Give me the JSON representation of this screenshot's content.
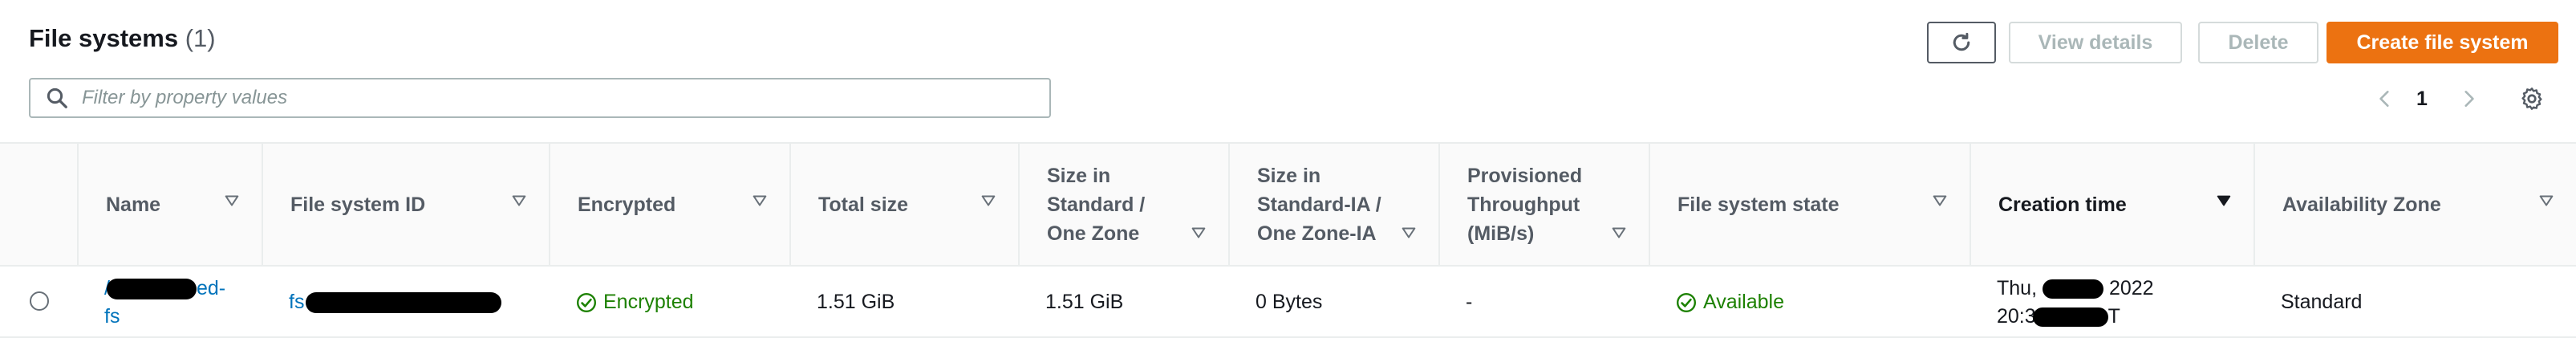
{
  "header": {
    "title": "File systems",
    "count": "(1)"
  },
  "toolbar": {
    "refresh_icon": "refresh-icon",
    "view_details_label": "View details",
    "delete_label": "Delete",
    "create_label": "Create file system"
  },
  "search": {
    "placeholder": "Filter by property values",
    "value": ""
  },
  "pagination": {
    "current_page": "1"
  },
  "table": {
    "columns": [
      "Name",
      "File system ID",
      "Encrypted",
      "Total size",
      "Size in Standard / One Zone",
      "Size in Standard-IA / One Zone-IA",
      "Provisioned Throughput (MiB/s)",
      "File system state",
      "Creation time",
      "Availability Zone"
    ],
    "sorted_column": "Creation time",
    "rows": [
      {
        "name_prefix": "/",
        "name_mid": "ed-",
        "name_suffix": "fs",
        "file_system_id_prefix": "fs",
        "encrypted": "Encrypted",
        "total_size": "1.51 GiB",
        "size_standard": "1.51 GiB",
        "size_ia": "0 Bytes",
        "provisioned_throughput": "-",
        "state": "Available",
        "creation_line1_a": "Thu,",
        "creation_line1_b": "2022",
        "creation_line2_a": "20:3",
        "creation_line2_b": "T",
        "availability_zone": "Standard"
      }
    ]
  },
  "colors": {
    "primary_button": "#ec7211",
    "link": "#0073bb",
    "success": "#1d8102"
  }
}
